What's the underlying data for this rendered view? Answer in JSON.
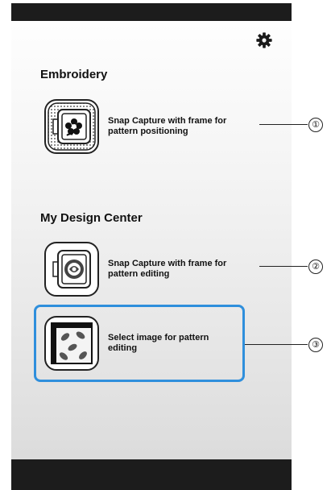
{
  "sections": {
    "embroidery": {
      "title": "Embroidery"
    },
    "design_center": {
      "title": "My Design Center"
    }
  },
  "items": [
    {
      "label": "Snap Capture with frame for pattern positioning",
      "icon": "embroidery-frame-flower-icon",
      "callout": "①"
    },
    {
      "label": "Snap Capture with frame for pattern editing",
      "icon": "embroidery-frame-rose-icon",
      "callout": "②"
    },
    {
      "label": "Select image for pattern editing",
      "icon": "leaf-pattern-image-icon",
      "callout": "③"
    }
  ],
  "header": {
    "settings_icon": "gear-icon"
  },
  "colors": {
    "highlight": "#2f8fdc",
    "status_bar": "#1c1c1c"
  }
}
